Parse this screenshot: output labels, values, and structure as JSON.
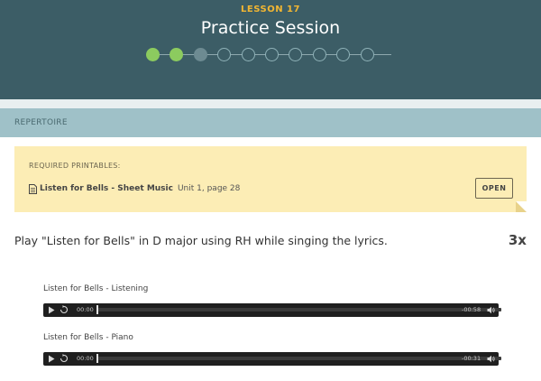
{
  "header": {
    "lesson_label": "LESSON 17",
    "title": "Practice Session",
    "progress": {
      "total_steps": 10,
      "completed_steps": 2,
      "current_step": 3
    }
  },
  "section": {
    "title": "REPERTOIRE"
  },
  "printables": {
    "label": "REQUIRED PRINTABLES:",
    "items": [
      {
        "icon": "document-icon",
        "title": "Listen for Bells - Sheet Music",
        "reference": "Unit 1, page 28",
        "button_label": "OPEN"
      }
    ]
  },
  "exercise": {
    "instruction": "Play \"Listen for Bells\" in D major using RH while singing the lyrics.",
    "repetitions": "3x"
  },
  "audio": [
    {
      "label": "Listen for Bells - Listening",
      "current_time": "00:00",
      "remaining_time": "-00:58"
    },
    {
      "label": "Listen for Bells - Piano",
      "current_time": "00:00",
      "remaining_time": "-00:31"
    }
  ],
  "colors": {
    "header_bg": "#3c5d66",
    "lesson_accent": "#f2b632",
    "progress_done": "#8ccb5f",
    "section_bar": "#9fc1c8",
    "note_bg": "#fcedb5",
    "player_bg": "#1f1f1f"
  }
}
